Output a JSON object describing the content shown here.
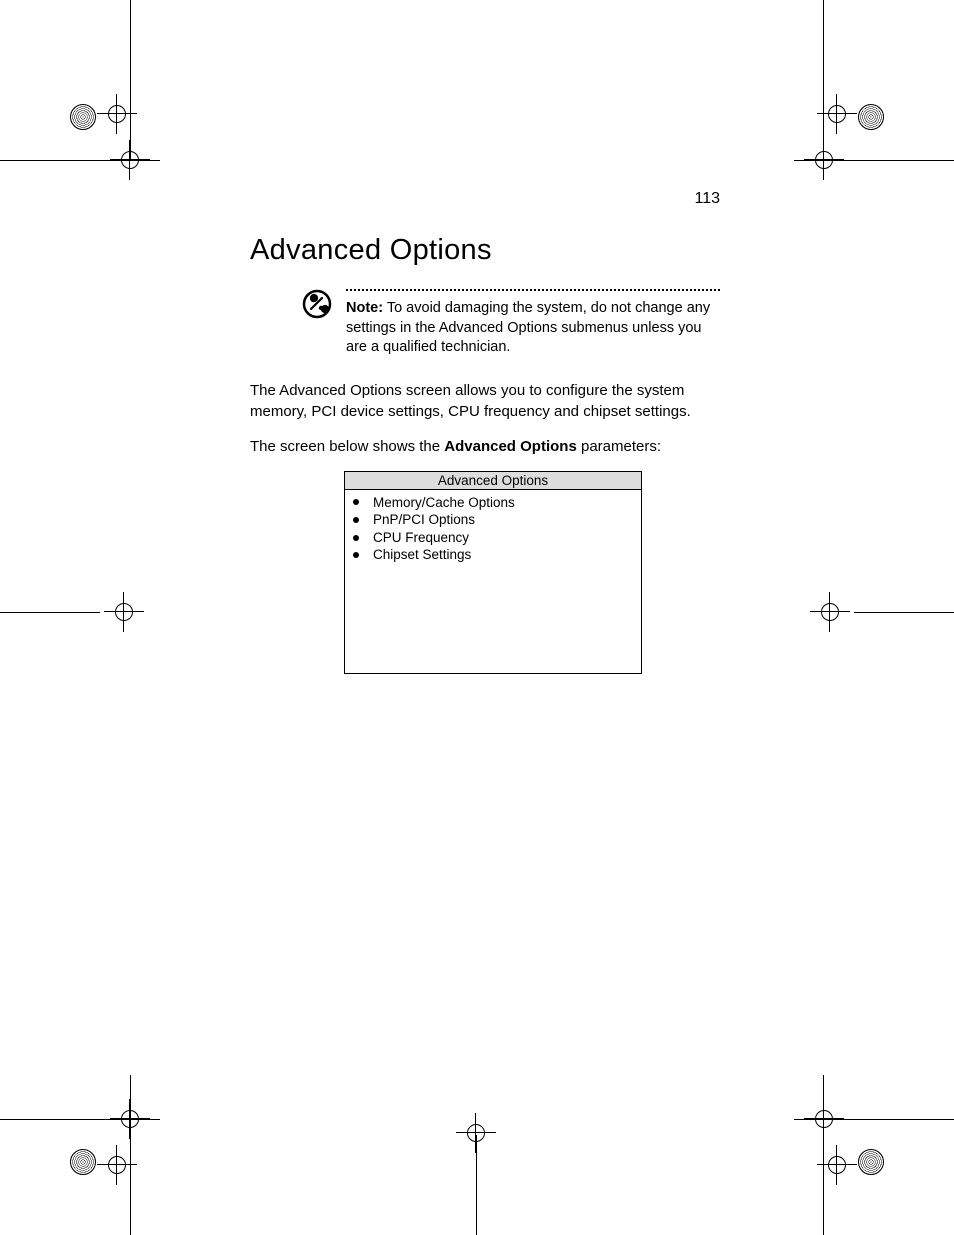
{
  "page_number": "113",
  "heading": "Advanced Options",
  "note": {
    "label": "Note:",
    "text": "To avoid damaging the system, do not change any settings in the Advanced Options submenus unless  you are a qualified technician."
  },
  "para1": "The Advanced Options screen allows you to configure the system memory, PCI device settings, CPU frequency and chipset settings.",
  "para2_pre": "The screen below shows the ",
  "para2_bold": "Advanced Options",
  "para2_post": " parameters:",
  "screenshot": {
    "title": "Advanced Options",
    "items": [
      "Memory/Cache Options",
      "PnP/PCI Options",
      "CPU Frequency",
      "Chipset Settings"
    ]
  }
}
